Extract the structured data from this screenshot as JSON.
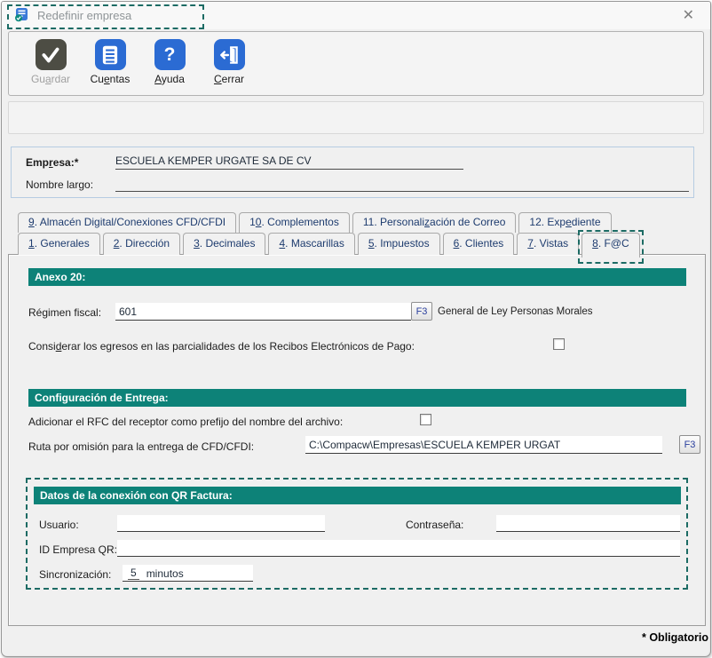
{
  "window": {
    "title": "Redefinir empresa",
    "close_glyph": "✕",
    "footer_note": "* Obligatorio"
  },
  "colors": {
    "header_teal": "#0d8278",
    "annotation_teal": "#1c6b64",
    "icon_blue": "#2b6bd3",
    "disabled_icon": "#4d4d44"
  },
  "toolbar": {
    "buttons": [
      {
        "name": "guardar",
        "label": "Gu&ardar",
        "icon": "save-check-icon",
        "disabled": true
      },
      {
        "name": "cuentas",
        "label": "Cu&entas",
        "icon": "accounts-list-icon",
        "disabled": false
      },
      {
        "name": "ayuda",
        "label": "&Ayuda",
        "icon": "help-question-icon",
        "disabled": false
      },
      {
        "name": "cerrar",
        "label": "&Cerrar",
        "icon": "exit-door-icon",
        "disabled": false
      }
    ]
  },
  "company": {
    "empresa_label": "Emp&resa:*",
    "empresa_value": "ESCUELA KEMPER URGATE SA DE CV",
    "nombre_largo_label": "Nombre largo:",
    "nombre_largo_value": ""
  },
  "tabs": {
    "row1": [
      {
        "name": "tab-9-almacen-digital",
        "label": "&9. Almacén Digital/Conexiones CFD/CFDI",
        "active": false
      },
      {
        "name": "tab-10-complementos",
        "label": "1&0. Complementos",
        "active": false
      },
      {
        "name": "tab-11-personalizacion-correo",
        "label": "11. Personali&zación de Correo",
        "active": false
      },
      {
        "name": "tab-12-expediente",
        "label": "12. Exp&ediente",
        "active": false
      }
    ],
    "row2": [
      {
        "name": "tab-1-generales",
        "label": "&1. Generales",
        "active": false
      },
      {
        "name": "tab-2-direccion",
        "label": "&2. Dirección",
        "active": false
      },
      {
        "name": "tab-3-decimales",
        "label": "&3. Decimales",
        "active": false
      },
      {
        "name": "tab-4-mascarillas",
        "label": "&4. Mascarillas",
        "active": false
      },
      {
        "name": "tab-5-impuestos",
        "label": "&5. Impuestos",
        "active": false
      },
      {
        "name": "tab-6-clientes",
        "label": "&6. Clientes",
        "active": false
      },
      {
        "name": "tab-7-vistas",
        "label": "&7. Vistas",
        "active": false
      },
      {
        "name": "tab-8-fac",
        "label": "&8. F@C",
        "active": true
      }
    ]
  },
  "anexo20": {
    "header": "Anexo 20:",
    "regimen_label": "Régimen fiscal:",
    "regimen_value": "601",
    "regimen_f3": "F3",
    "regimen_desc": "General de Ley Personas Morales",
    "egresos_label": "Consi&derar los egresos en las parcialidades de los Recibos Electrónicos de Pago:",
    "egresos_checked": false
  },
  "entrega": {
    "header": "Configuración de Entrega:",
    "rfc_prefijo_label": "Adicionar el RFC del receptor como prefijo del nombre del archivo:",
    "rfc_prefijo_checked": false,
    "ruta_label": "Ruta por omisión para la entrega de CFD/CFDI:",
    "ruta_value": "C:\\Compacw\\Empresas\\ESCUELA KEMPER URGAT",
    "ruta_f3": "F3"
  },
  "qr_factura": {
    "header": "Datos de la conexión con QR Factura:",
    "usuario_label": "Usuario:",
    "usuario_value": "",
    "contrasena_label": "Contraseña:",
    "contrasena_value": "",
    "id_empresa_label": "ID Empresa QR:",
    "id_empresa_value": "",
    "sincronizacion_label": "Sincronización:",
    "sincronizacion_value": "5",
    "sincronizacion_unit": "minutos"
  }
}
